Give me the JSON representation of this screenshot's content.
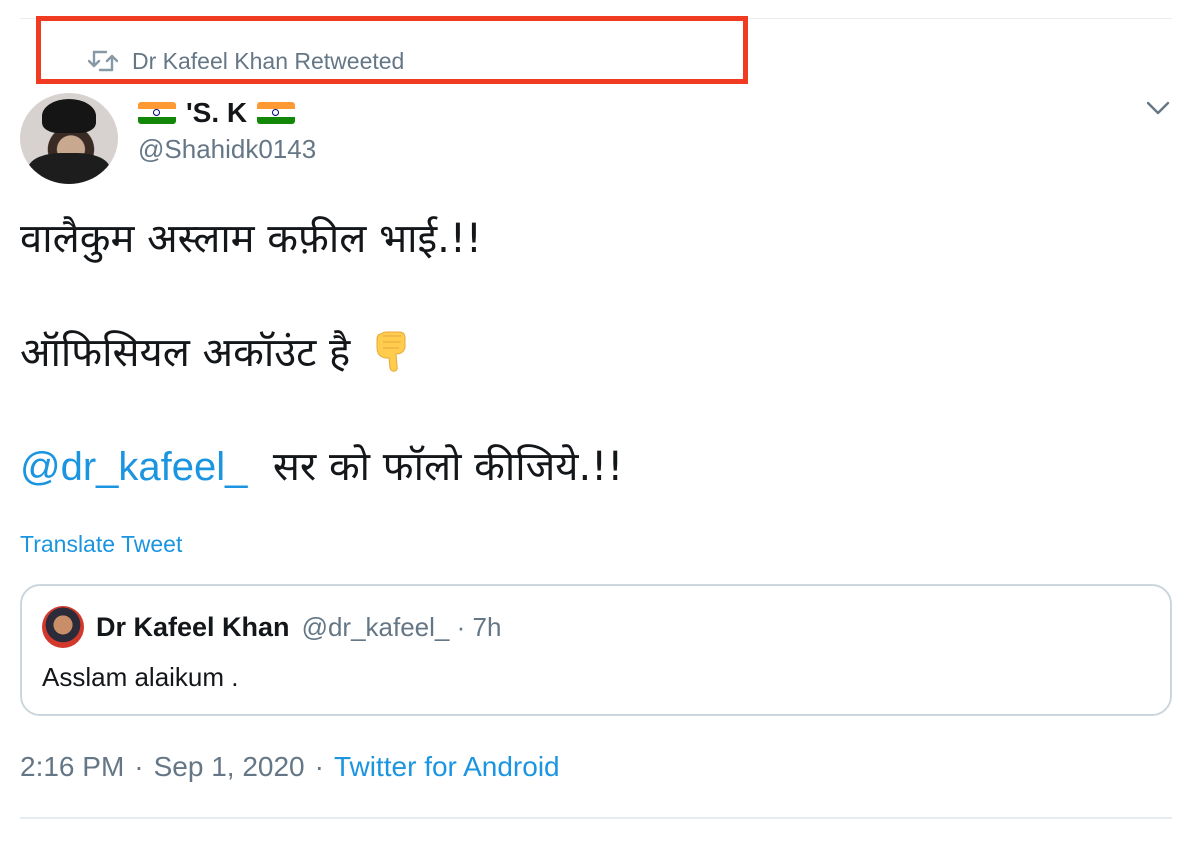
{
  "retweet": {
    "text": "Dr Kafeel Khan Retweeted",
    "icon": "retweet-icon"
  },
  "author": {
    "display_name": "'S. K",
    "handle": "@Shahidk0143",
    "flag_icon": "india-flag-icon"
  },
  "tweet": {
    "line1": "वालैकुम अस्लाम कफ़ील भाई.!!",
    "line2": "ऑफिसियल अकॉउंट है",
    "line2_emoji": "pointing-down-hand-icon",
    "mention": "@dr_kafeel_",
    "line3_rest": "सर को फॉलो कीजिये.!!",
    "translate_label": "Translate Tweet"
  },
  "quoted": {
    "name": "Dr Kafeel Khan",
    "handle_time": "@dr_kafeel_ · 7h",
    "body": "Asslam alaikum ."
  },
  "meta": {
    "time": "2:16 PM",
    "sep1": "·",
    "date": "Sep 1, 2020",
    "sep2": "·",
    "source": "Twitter for Android"
  },
  "colors": {
    "highlight": "#f03a22",
    "link": "#1b95e0",
    "muted": "#657786",
    "border": "#ccd6dd"
  }
}
